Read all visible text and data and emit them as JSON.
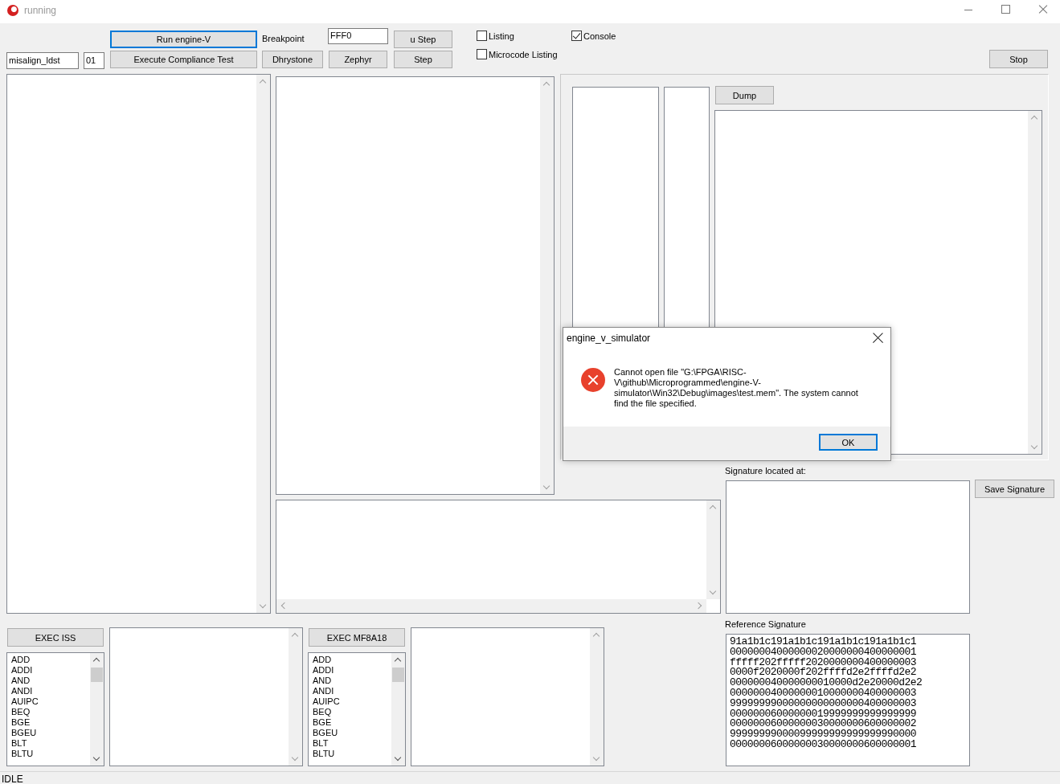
{
  "window": {
    "title": "running"
  },
  "buttons": [
    {
      "label": "Run engine-V",
      "focused": true
    },
    {
      "label": "u Step",
      "focused": false
    },
    {
      "label": "Execute Compliance Test",
      "focused": false
    },
    {
      "label": "Dhrystone",
      "focused": false
    },
    {
      "label": "Zephyr",
      "focused": false
    },
    {
      "label": "Step",
      "focused": false
    },
    {
      "label": "Stop",
      "focused": false
    },
    {
      "label": "Dump",
      "focused": false
    },
    {
      "label": "Save Signature",
      "focused": false
    }
  ],
  "breakpoint": {
    "label": "Breakpoint",
    "value": "FFF0"
  },
  "test_name": {
    "value": "misalign_ldst"
  },
  "test_index": {
    "value": "01"
  },
  "checkboxes": [
    {
      "label": "Listing",
      "checked": false
    },
    {
      "label": "Console",
      "checked": true
    },
    {
      "label": "Microcode Listing",
      "checked": false
    }
  ],
  "signature": {
    "label": "Signature located at:"
  },
  "reference_signature": {
    "label": "Reference Signature",
    "lines": [
      "91a1b1c191a1b1c191a1b1c191a1b1c1",
      "00000004000000020000000400000001",
      "fffff202fffff2020000000400000003",
      "0000f2020000f202ffffd2e2ffffd2e2",
      "000000040000000010000d2e20000d2e2",
      "00000004000000010000000400000003",
      "99999999000000000000000400000003",
      "00000006000000019999999999999999",
      "00000006000000030000000600000002",
      "99999999000099999999999999990000",
      "00000006000000030000000600000001"
    ]
  },
  "exec_panels": [
    {
      "button": "EXEC ISS",
      "items": [
        "ADD",
        "ADDI",
        "AND",
        "ANDI",
        "AUIPC",
        "BEQ",
        "BGE",
        "BGEU",
        "BLT",
        "BLTU"
      ]
    },
    {
      "button": "EXEC MF8A18",
      "items": [
        "ADD",
        "ADDI",
        "AND",
        "ANDI",
        "AUIPC",
        "BEQ",
        "BGE",
        "BGEU",
        "BLT",
        "BLTU"
      ]
    }
  ],
  "dialog": {
    "title": "engine_v_simulator",
    "message": "Cannot open file \"G:\\FPGA\\RISC-V\\github\\Microprogrammed\\engine-V-simulator\\Win32\\Debug\\images\\test.mem\". The system cannot find the file specified.",
    "button": "OK"
  },
  "status_bar": {
    "text": "IDLE"
  }
}
